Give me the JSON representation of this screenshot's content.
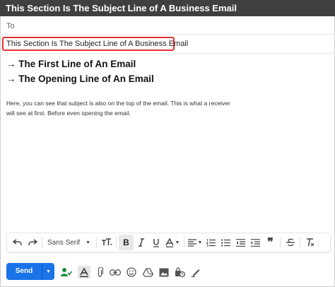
{
  "window": {
    "title": "This Section Is The Subject Line of A Business Email"
  },
  "compose": {
    "to_placeholder": "To",
    "subject": "This Section Is The Subject Line of A Business Email",
    "lines": [
      "→ The First Line of An Email",
      "→ The Opening Line of An Email"
    ],
    "paragraph": [
      "Here, you can see that subject is also on the top of the email. This is what a receiver",
      "will see at first. Before even opening the email."
    ],
    "highlight_color": "#e53333"
  },
  "toolbar": {
    "font_family": "Sans Serif",
    "icons": [
      "undo-icon",
      "redo-icon",
      "font-select",
      "text-size-icon",
      "bold-icon",
      "italic-icon",
      "underline-icon",
      "text-color-icon",
      "align-icon",
      "numbered-list-icon",
      "bulleted-list-icon",
      "indent-less-icon",
      "indent-more-icon",
      "quote-icon",
      "strikethrough-icon",
      "remove-formatting-icon"
    ]
  },
  "bottom": {
    "send_label": "Send",
    "send_color": "#1a73e8",
    "icons": [
      "assistant-icon",
      "formatting-icon",
      "attach-icon",
      "link-icon",
      "emoji-icon",
      "drive-icon",
      "photo-icon",
      "confidential-icon",
      "signature-icon"
    ]
  }
}
